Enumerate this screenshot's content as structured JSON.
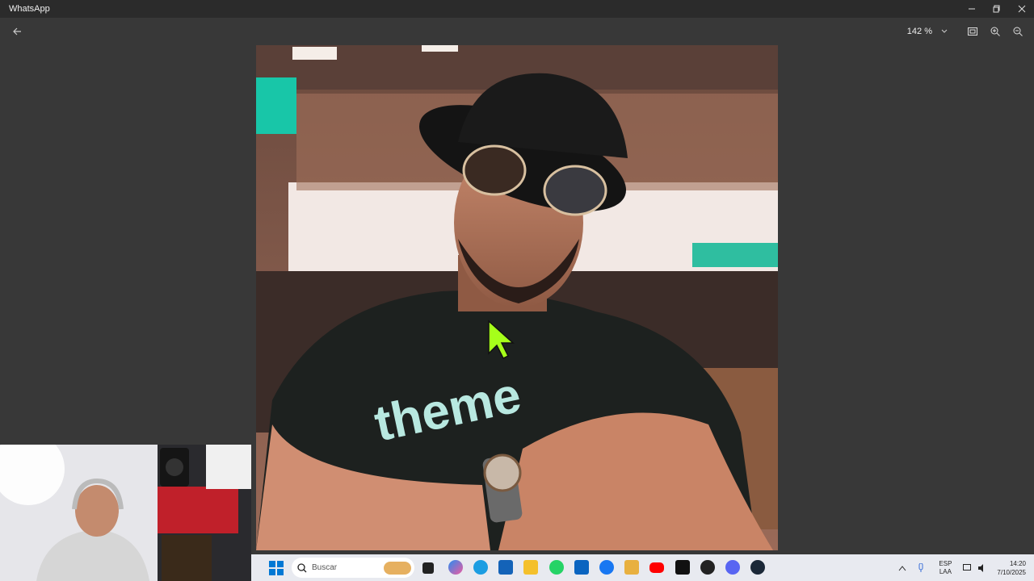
{
  "window": {
    "title": "WhatsApp"
  },
  "toolbar": {
    "zoom_label": "142 %"
  },
  "taskbar": {
    "search_placeholder": "Buscar",
    "language_top": "ESP",
    "language_bottom": "LAA",
    "time": "14:20",
    "date": "7/10/2025"
  },
  "colors": {
    "background": "#383838",
    "titlebar": "#2b2b2b",
    "taskbar": "#e8eaf0",
    "accent": "#0078d4"
  },
  "icons": [
    "back-arrow-icon",
    "minimize-icon",
    "maximize-icon",
    "close-icon",
    "chevron-down-icon",
    "fit-screen-icon",
    "zoom-in-icon",
    "zoom-out-icon",
    "windows-start-icon",
    "search-icon"
  ]
}
